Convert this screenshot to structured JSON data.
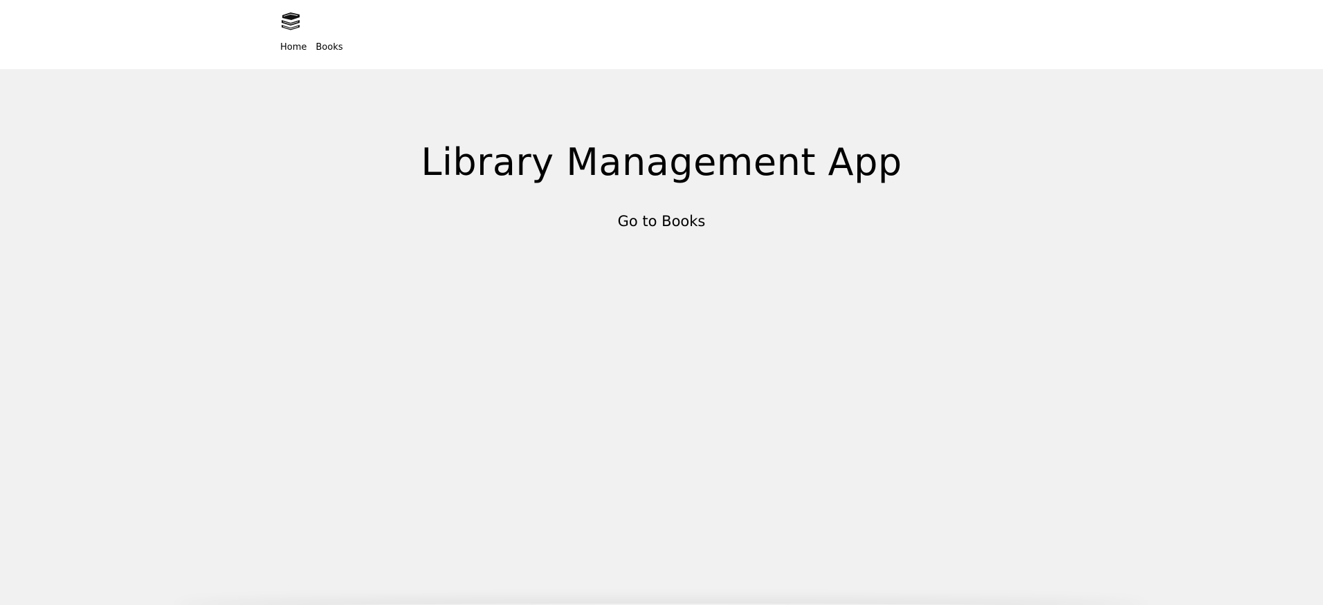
{
  "header": {
    "logo_icon": "books-stack-icon",
    "nav": [
      {
        "label": "Home"
      },
      {
        "label": "Books"
      }
    ]
  },
  "main": {
    "title": "Library Management App",
    "cta_label": "Go to Books"
  },
  "colors": {
    "header_bg": "#ffffff",
    "page_bg": "#f1f1f1",
    "text": "#000000"
  }
}
